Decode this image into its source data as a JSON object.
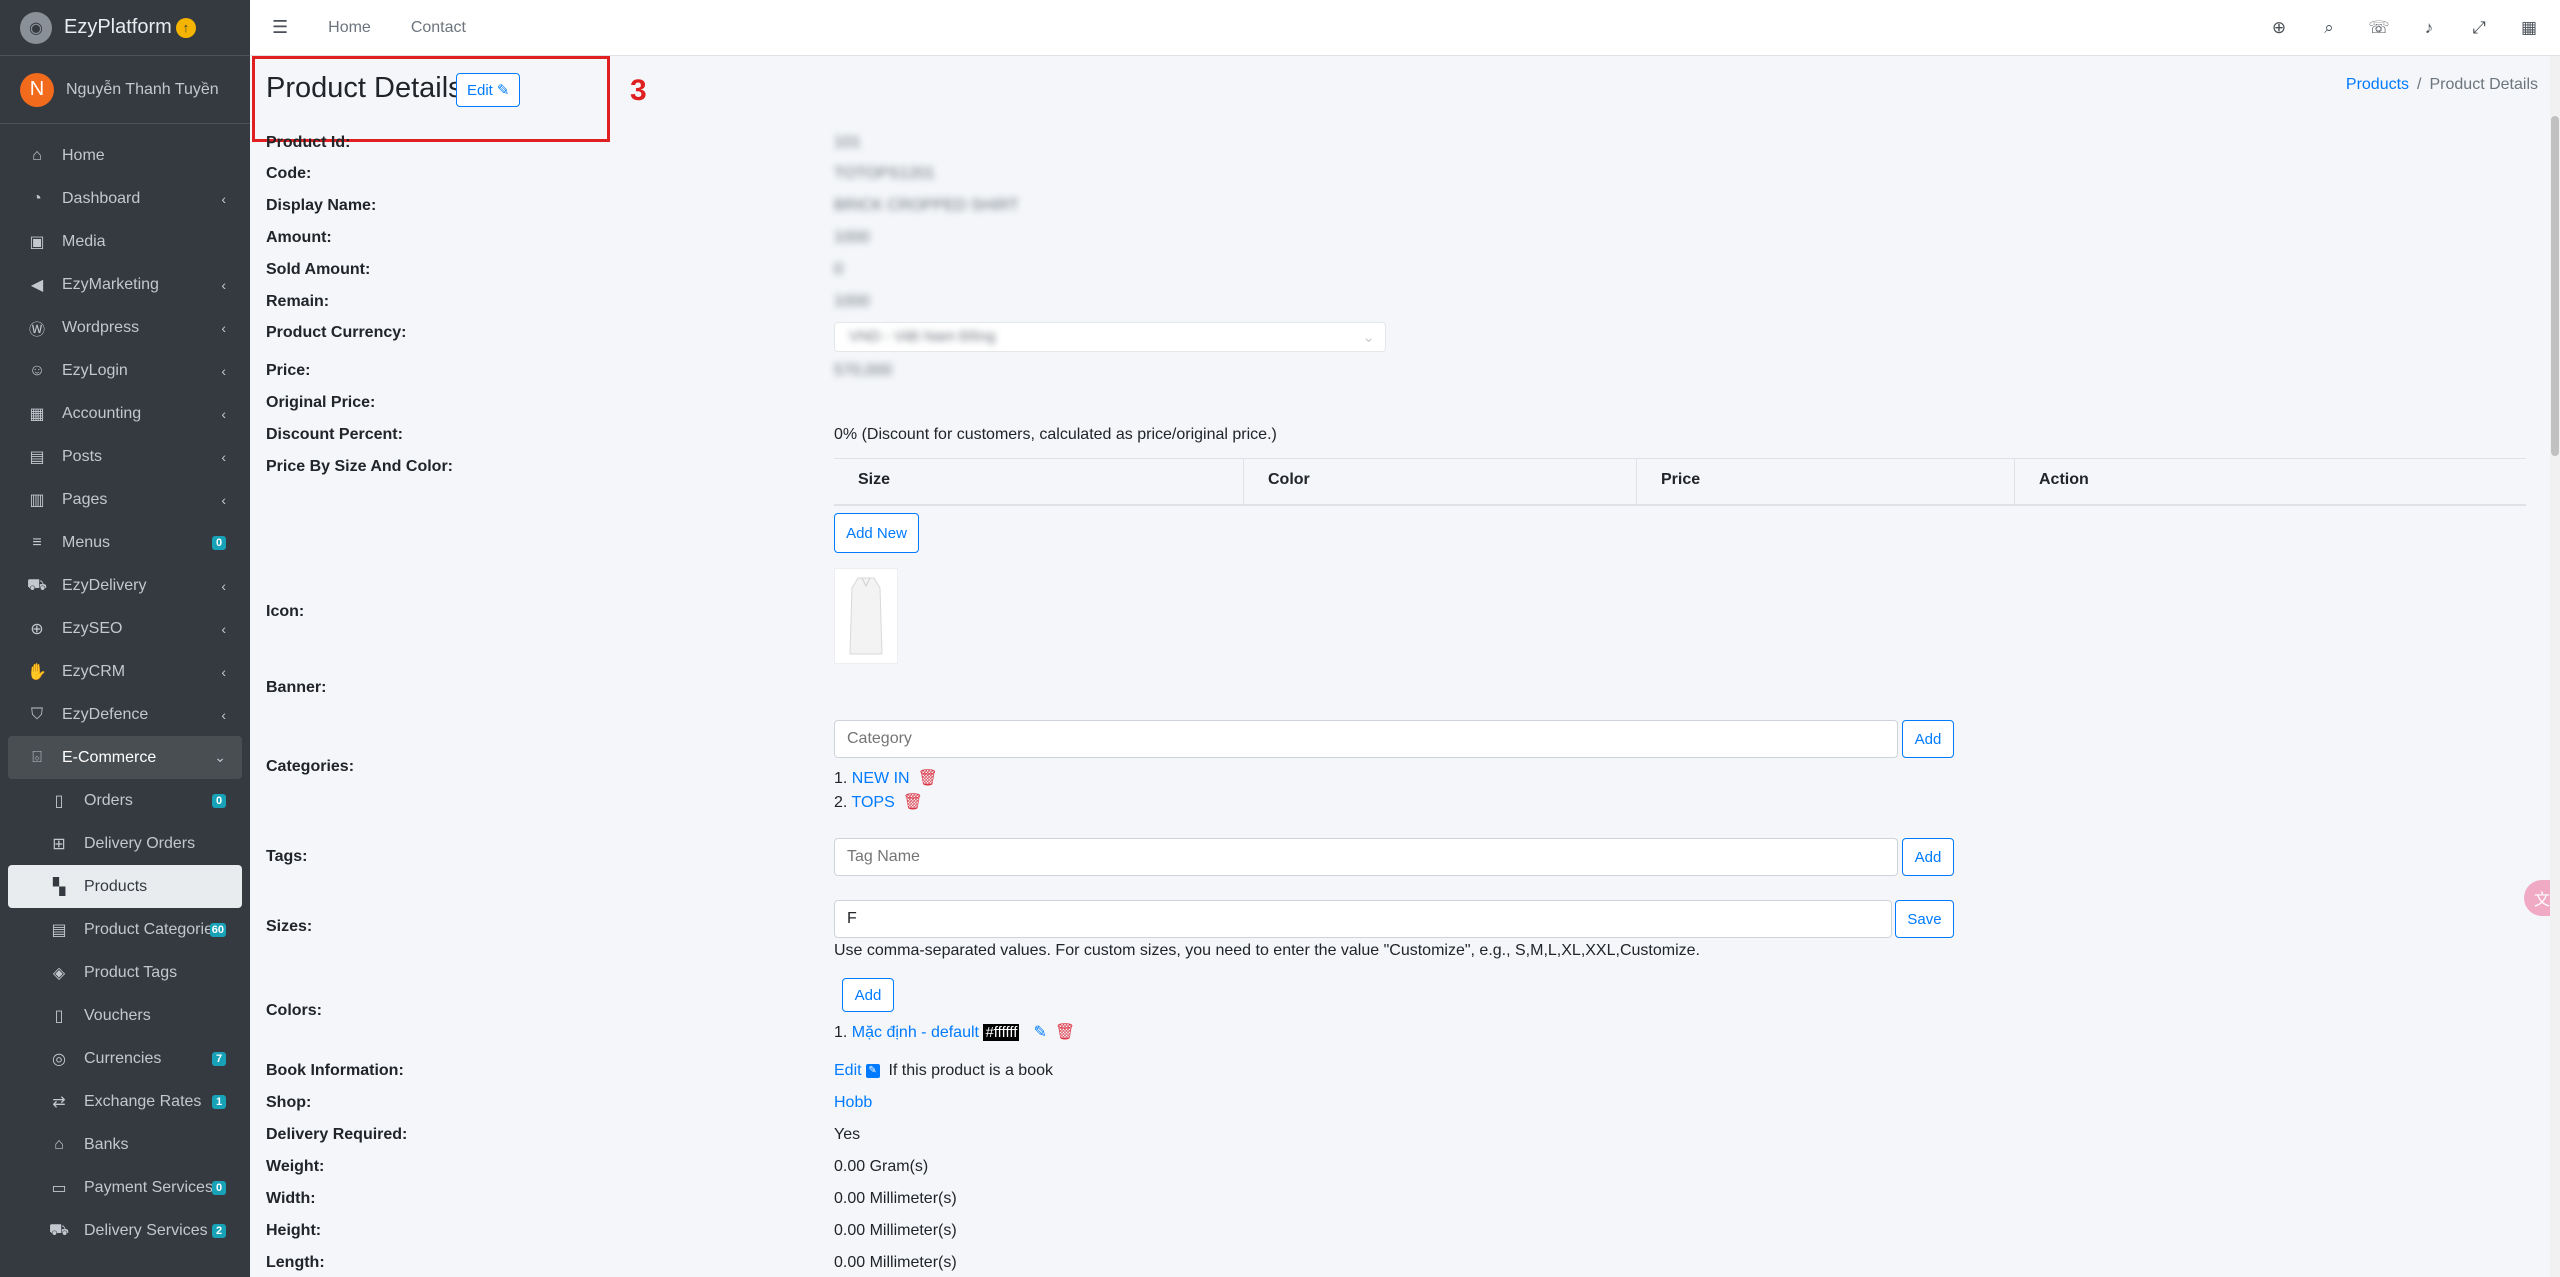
{
  "brand": {
    "name": "EzyPlatform",
    "badge_icon": "arrow-up-circle-icon"
  },
  "user": {
    "initial": "N",
    "name": "Nguyễn Thanh Tuyền"
  },
  "sidebar": {
    "items": [
      {
        "label": "Home",
        "icon": "home-icon"
      },
      {
        "label": "Dashboard",
        "icon": "dashboard-icon",
        "arrow": "‹"
      },
      {
        "label": "Media",
        "icon": "image-icon"
      },
      {
        "label": "EzyMarketing",
        "icon": "bullhorn-icon",
        "arrow": "‹"
      },
      {
        "label": "Wordpress",
        "icon": "wordpress-icon",
        "arrow": "‹"
      },
      {
        "label": "EzyLogin",
        "icon": "user-lock-icon",
        "arrow": "‹"
      },
      {
        "label": "Accounting",
        "icon": "calculator-icon",
        "arrow": "‹"
      },
      {
        "label": "Posts",
        "icon": "newspaper-icon",
        "arrow": "‹"
      },
      {
        "label": "Pages",
        "icon": "pages-icon",
        "arrow": "‹"
      },
      {
        "label": "Menus",
        "icon": "bars-icon",
        "badge": "0"
      },
      {
        "label": "EzyDelivery",
        "icon": "truck-icon",
        "arrow": "‹"
      },
      {
        "label": "EzySEO",
        "icon": "search-plus-icon",
        "arrow": "‹"
      },
      {
        "label": "EzyCRM",
        "icon": "handshake-icon",
        "arrow": "‹"
      },
      {
        "label": "EzyDefence",
        "icon": "shield-icon",
        "arrow": "‹"
      },
      {
        "label": "E-Commerce",
        "icon": "basket-icon",
        "arrow": "⌄"
      }
    ],
    "sub_items": [
      {
        "label": "Orders",
        "icon": "clipboard-icon",
        "badge": "0"
      },
      {
        "label": "Delivery Orders",
        "icon": "dolly-icon"
      },
      {
        "label": "Products",
        "icon": "boxes-icon"
      },
      {
        "label": "Product Categories",
        "icon": "clipboard-list-icon",
        "badge": "60"
      },
      {
        "label": "Product Tags",
        "icon": "tags-icon"
      },
      {
        "label": "Vouchers",
        "icon": "clipboard-icon"
      },
      {
        "label": "Currencies",
        "icon": "coins-icon",
        "badge": "7"
      },
      {
        "label": "Exchange Rates",
        "icon": "exchange-icon",
        "badge": "1"
      },
      {
        "label": "Banks",
        "icon": "bank-icon"
      },
      {
        "label": "Payment Services",
        "icon": "credit-card-icon",
        "badge": "0"
      },
      {
        "label": "Delivery Services",
        "icon": "truck-icon",
        "badge": "2"
      }
    ]
  },
  "topbar": {
    "links": [
      "Home",
      "Contact"
    ],
    "icons": [
      "globe-icon",
      "search-icon",
      "comments-icon",
      "bell-icon",
      "expand-icon",
      "grid-icon"
    ]
  },
  "page": {
    "title": "Product Details",
    "edit_label": "Edit",
    "step_marker": "3",
    "breadcrumb": {
      "parent": "Products",
      "current": "Product Details"
    }
  },
  "fields": {
    "product_id": {
      "label": "Product Id:",
      "value": "101"
    },
    "code": {
      "label": "Code:",
      "value": "TOTOPS1201"
    },
    "display_name": {
      "label": "Display Name:",
      "value": "BRICK CROPPED SHIRT"
    },
    "amount": {
      "label": "Amount:",
      "value": "1000"
    },
    "sold_amount": {
      "label": "Sold Amount:",
      "value": "0"
    },
    "remain": {
      "label": "Remain:",
      "value": "1000"
    },
    "currency": {
      "label": "Product Currency:",
      "value": "VND - Việt Nam Đồng"
    },
    "price": {
      "label": "Price:",
      "value": "570,000"
    },
    "original_price": {
      "label": "Original Price:",
      "value": ""
    },
    "discount": {
      "label": "Discount Percent:",
      "value": "0% (Discount for customers, calculated as price/original price.)"
    },
    "price_by_size": {
      "label": "Price By Size And Color:",
      "columns": [
        "Size",
        "Color",
        "Price",
        "Action"
      ],
      "add_label": "Add New"
    },
    "icon": {
      "label": "Icon:"
    },
    "banner": {
      "label": "Banner:"
    },
    "categories": {
      "label": "Categories:",
      "placeholder": "Category",
      "add_label": "Add",
      "items": [
        {
          "index": "1.",
          "name": "NEW IN"
        },
        {
          "index": "2.",
          "name": "TOPS"
        }
      ]
    },
    "tags": {
      "label": "Tags:",
      "placeholder": "Tag Name",
      "add_label": "Add"
    },
    "sizes": {
      "label": "Sizes:",
      "value": "F",
      "save_label": "Save",
      "help": "Use comma-separated values. For custom sizes, you need to enter the value \"Customize\", e.g., S,M,L,XL,XXL,Customize."
    },
    "colors": {
      "label": "Colors:",
      "add_label": "Add",
      "items": [
        {
          "index": "1.",
          "name": "Mặc định - default",
          "hex": "#ffffff"
        }
      ]
    },
    "book_info": {
      "label": "Book Information:",
      "edit_label": "Edit",
      "note": "If this product is a book"
    },
    "shop": {
      "label": "Shop:",
      "value": "Hobb"
    },
    "delivery_required": {
      "label": "Delivery Required:",
      "value": "Yes"
    },
    "weight": {
      "label": "Weight:",
      "value": "0.00 Gram(s)"
    },
    "width": {
      "label": "Width:",
      "value": "0.00 Millimeter(s)"
    },
    "height": {
      "label": "Height:",
      "value": "0.00 Millimeter(s)"
    },
    "length": {
      "label": "Length:",
      "value": "0.00 Millimeter(s)"
    }
  },
  "colors": {
    "accent": "#007bff",
    "danger": "#dc3545",
    "sidebar_bg": "#343a40",
    "highlight": "#e02020"
  }
}
